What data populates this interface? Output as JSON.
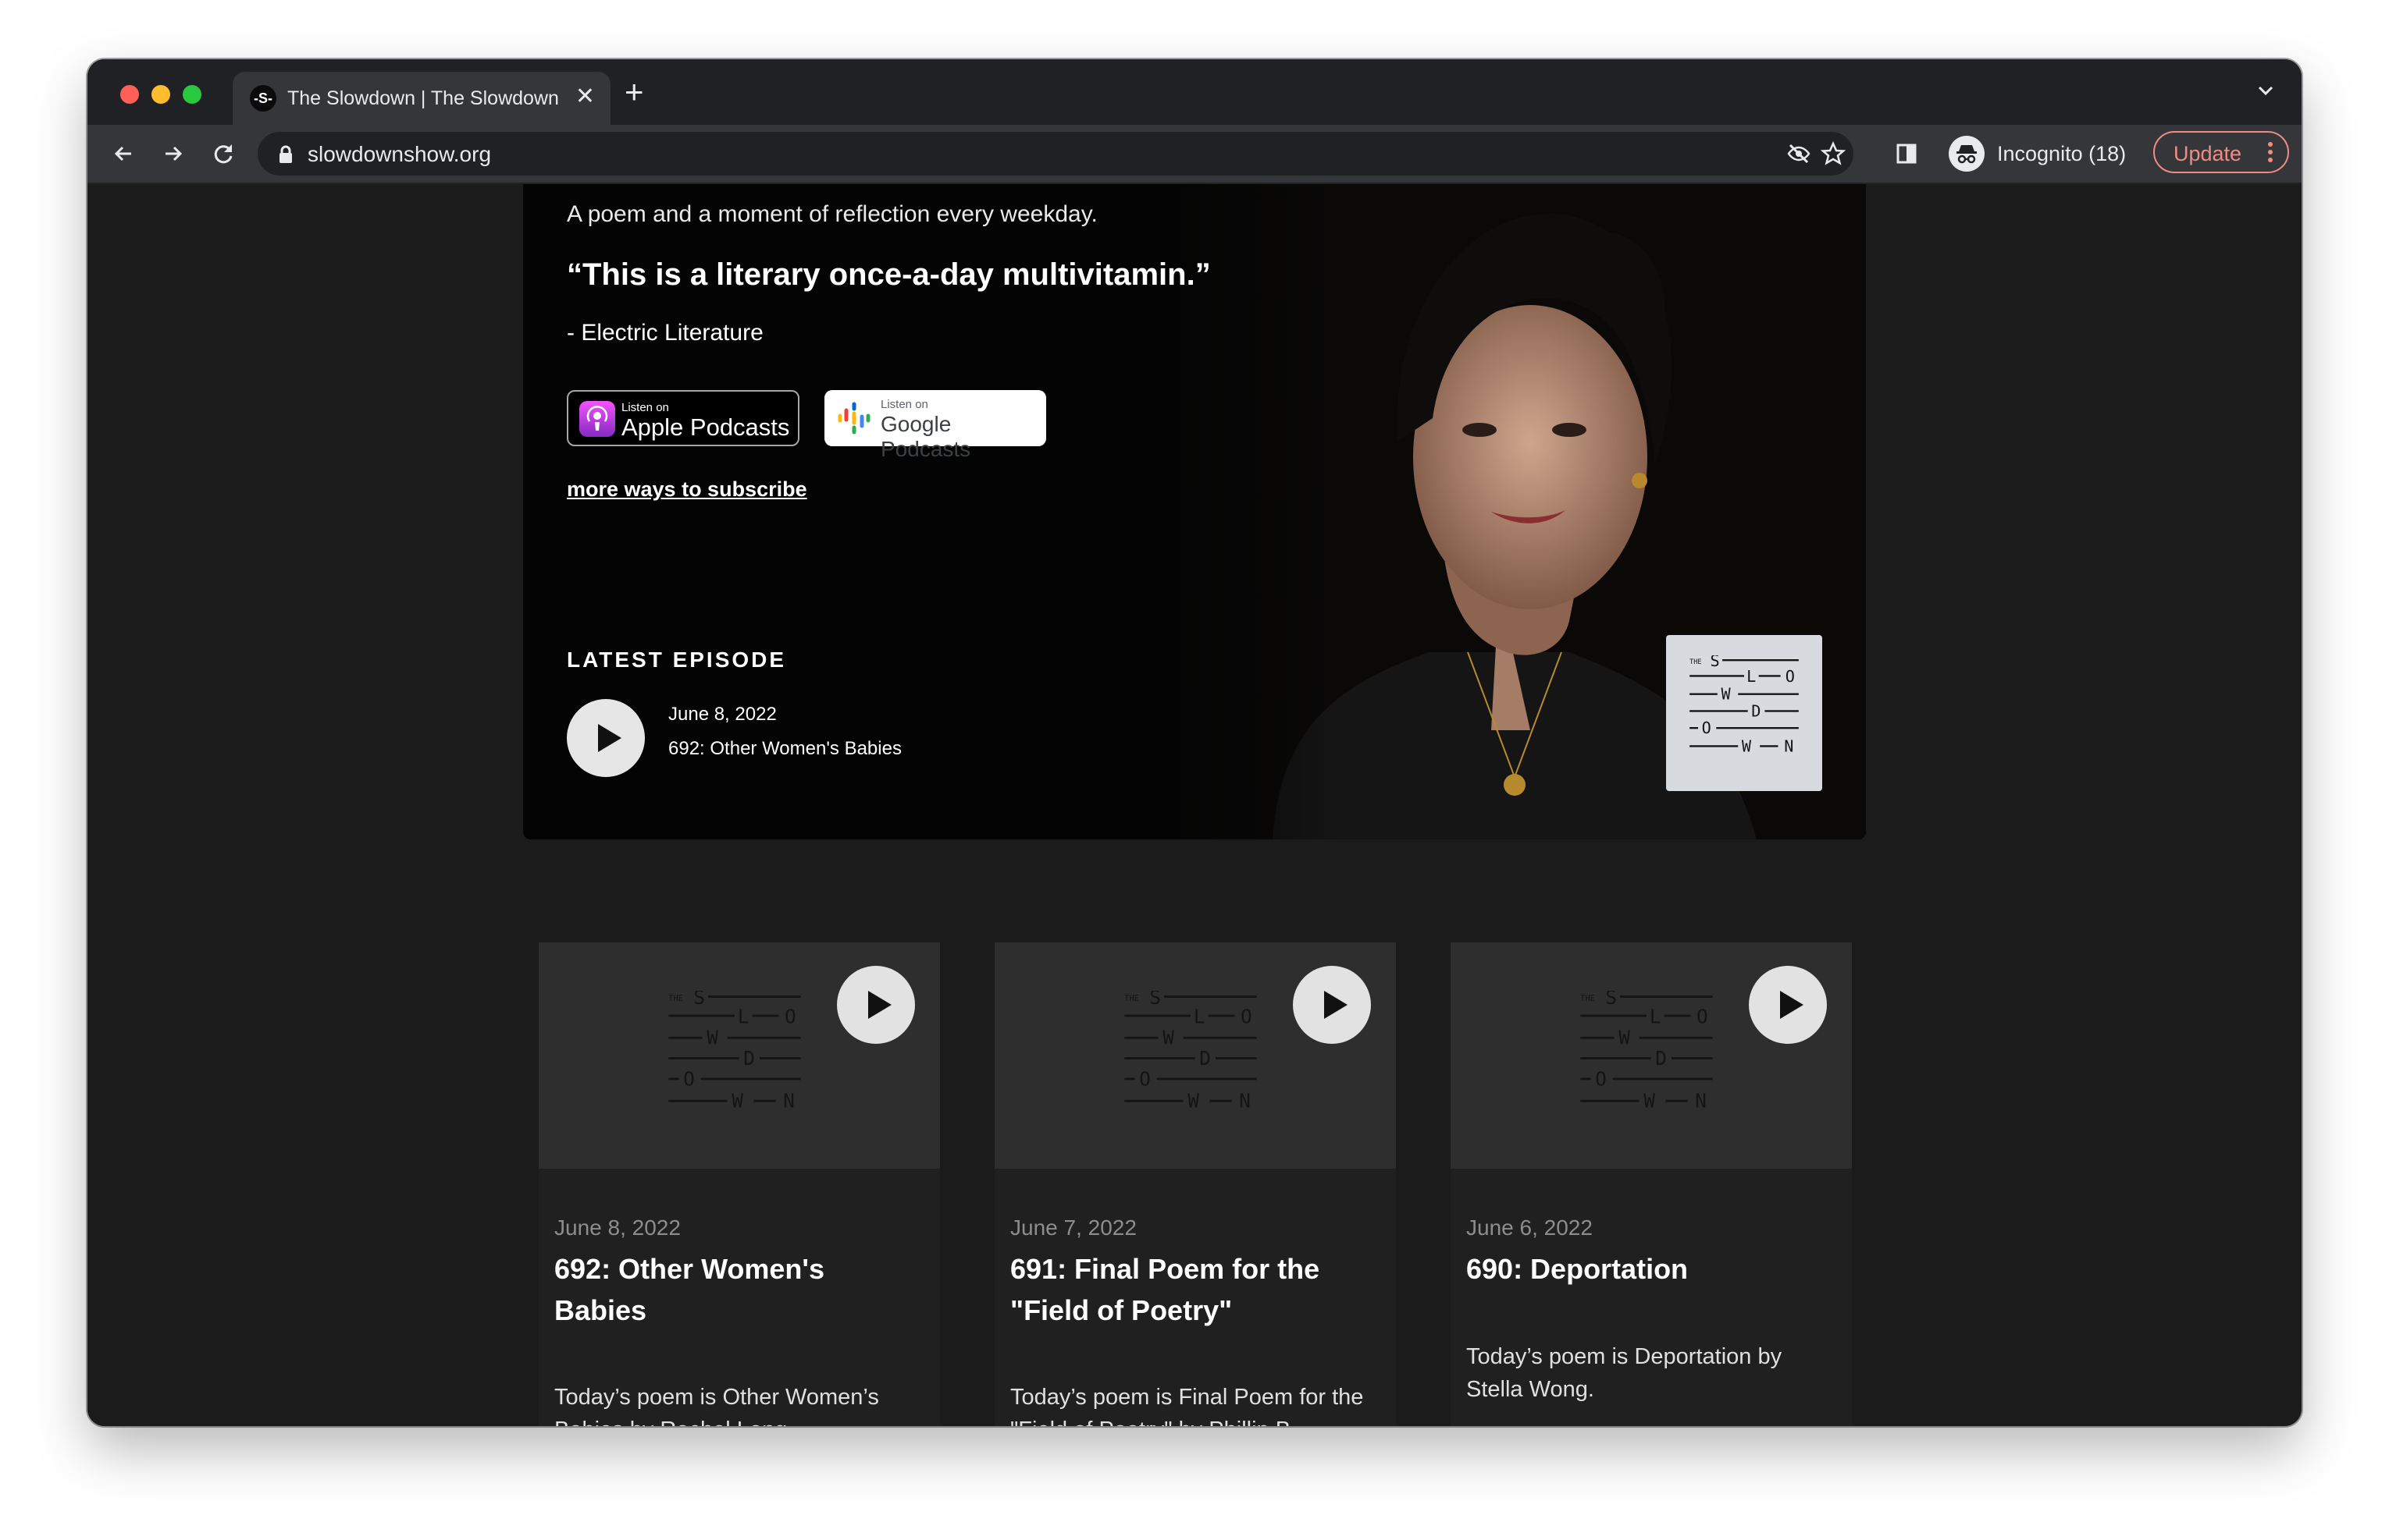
{
  "browser": {
    "tab_title": "The Slowdown | The Slowdown",
    "favicon_text": "-S-",
    "url": "slowdownshow.org",
    "profile_label": "Incognito (18)",
    "update_label": "Update"
  },
  "hero": {
    "tagline": "A poem and a moment of reflection every weekday.",
    "quote": "“This is a literary once-a-day multivitamin.”",
    "quote_source": "- Electric Literature",
    "apple_badge": {
      "small": "Listen on",
      "big": "Apple Podcasts"
    },
    "google_badge": {
      "small": "Listen on",
      "big": "Google Podcasts"
    },
    "subscribe_link": "more ways to subscribe",
    "latest_label": "LATEST EPISODE",
    "latest_date": "June 8, 2022",
    "latest_title": "692: Other Women's Babies"
  },
  "cards": [
    {
      "date": "June 8, 2022",
      "title": "692: Other Women's Babies",
      "description": "Today’s poem is Other Women’s Babies by Rachel Long."
    },
    {
      "date": "June 7, 2022",
      "title": "691: Final Poem for the \"Field of Poetry\"",
      "description": "Today’s poem is Final Poem for the \"Field of Poetry\" by Phillip B. Williams."
    },
    {
      "date": "June 6, 2022",
      "title": "690: Deportation",
      "description": "Today’s poem is Deportation by Stella Wong."
    }
  ]
}
